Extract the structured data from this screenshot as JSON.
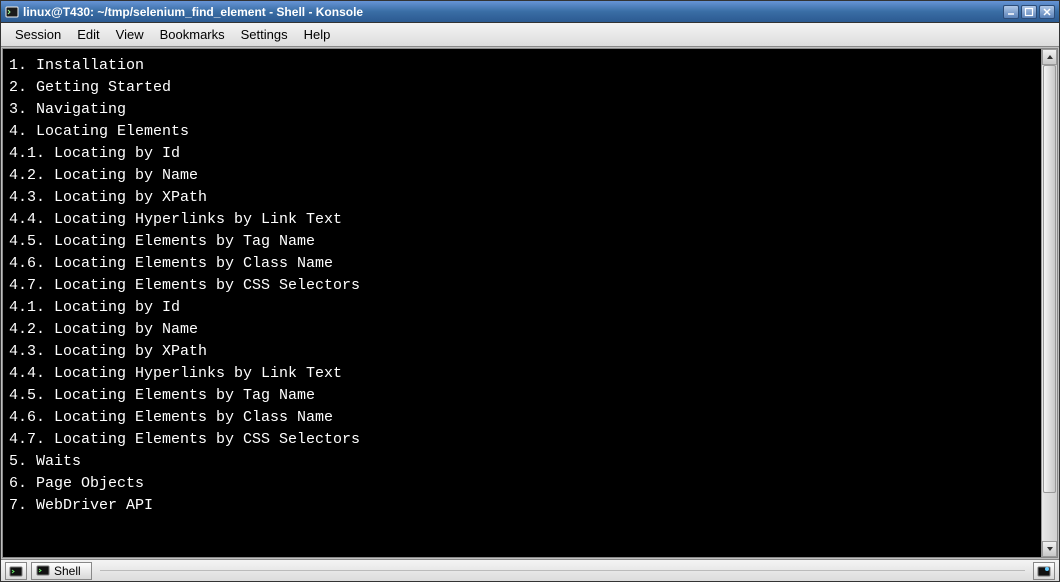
{
  "window": {
    "title": "linux@T430: ~/tmp/selenium_find_element - Shell - Konsole"
  },
  "menu": {
    "items": [
      "Session",
      "Edit",
      "View",
      "Bookmarks",
      "Settings",
      "Help"
    ]
  },
  "terminal": {
    "lines": [
      "1. Installation",
      "2. Getting Started",
      "3. Navigating",
      "4. Locating Elements",
      "4.1. Locating by Id",
      "4.2. Locating by Name",
      "4.3. Locating by XPath",
      "4.4. Locating Hyperlinks by Link Text",
      "4.5. Locating Elements by Tag Name",
      "4.6. Locating Elements by Class Name",
      "4.7. Locating Elements by CSS Selectors",
      "4.1. Locating by Id",
      "4.2. Locating by Name",
      "4.3. Locating by XPath",
      "4.4. Locating Hyperlinks by Link Text",
      "4.5. Locating Elements by Tag Name",
      "4.6. Locating Elements by Class Name",
      "4.7. Locating Elements by CSS Selectors",
      "5. Waits",
      "6. Page Objects",
      "7. WebDriver API"
    ]
  },
  "status": {
    "tab_label": "Shell"
  }
}
